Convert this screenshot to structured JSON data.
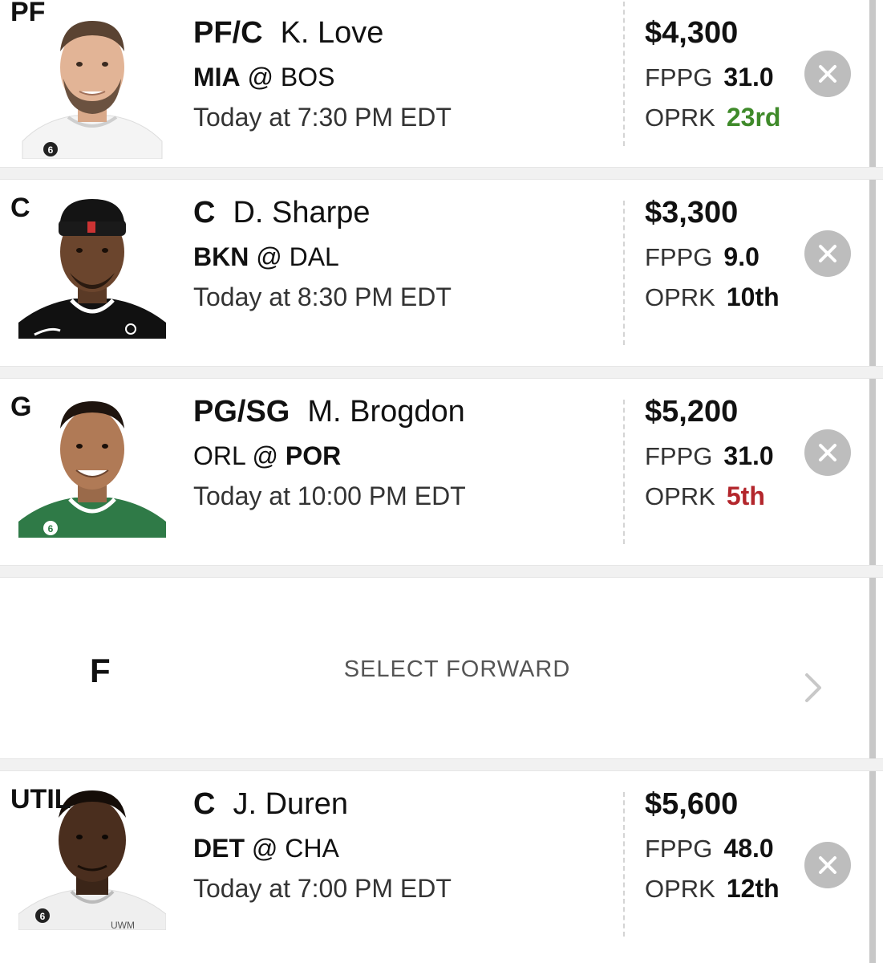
{
  "colors": {
    "green": "#3f8a2a",
    "red": "#b3262c",
    "remove_bg": "#bdbdbd",
    "separator": "#f1f1f1"
  },
  "slots": [
    {
      "slot_label": "PF",
      "player_position": "PF/C",
      "player_name": "K. Love",
      "matchup_team": "MIA",
      "matchup_at": "@",
      "matchup_opp": "BOS",
      "game_time": "Today at 7:30 PM EDT",
      "salary": "$4,300",
      "fppg_label": "FPPG",
      "fppg": "31.0",
      "oprk_label": "OPRK",
      "oprk": "23rd",
      "oprk_color": "green",
      "jersey": "white"
    },
    {
      "slot_label": "C",
      "player_position": "C",
      "player_name": "D. Sharpe",
      "matchup_team": "BKN",
      "matchup_at": "@",
      "matchup_opp": "DAL",
      "game_time": "Today at 8:30 PM EDT",
      "salary": "$3,300",
      "fppg_label": "FPPG",
      "fppg": "9.0",
      "oprk_label": "OPRK",
      "oprk": "10th",
      "oprk_color": "default",
      "jersey": "black"
    },
    {
      "slot_label": "G",
      "player_position": "PG/SG",
      "player_name": "M. Brogdon",
      "matchup_team": "ORL",
      "matchup_at": "@",
      "matchup_opp": "POR",
      "game_time": "Today at 10:00 PM EDT",
      "salary": "$5,200",
      "fppg_label": "FPPG",
      "fppg": "31.0",
      "oprk_label": "OPRK",
      "oprk": "5th",
      "oprk_color": "red",
      "jersey": "green"
    },
    {
      "slot_label": "UTIL",
      "player_position": "C",
      "player_name": "J. Duren",
      "matchup_team": "DET",
      "matchup_at": "@",
      "matchup_opp": "CHA",
      "game_time": "Today at 7:00 PM EDT",
      "salary": "$5,600",
      "fppg_label": "FPPG",
      "fppg": "48.0",
      "oprk_label": "OPRK",
      "oprk": "12th",
      "oprk_color": "default",
      "jersey": "white",
      "jersey_text": "UWM"
    }
  ],
  "empty_slot": {
    "slot_label": "F",
    "select_label": "SELECT FORWARD",
    "icon": "chevron-right-icon"
  }
}
